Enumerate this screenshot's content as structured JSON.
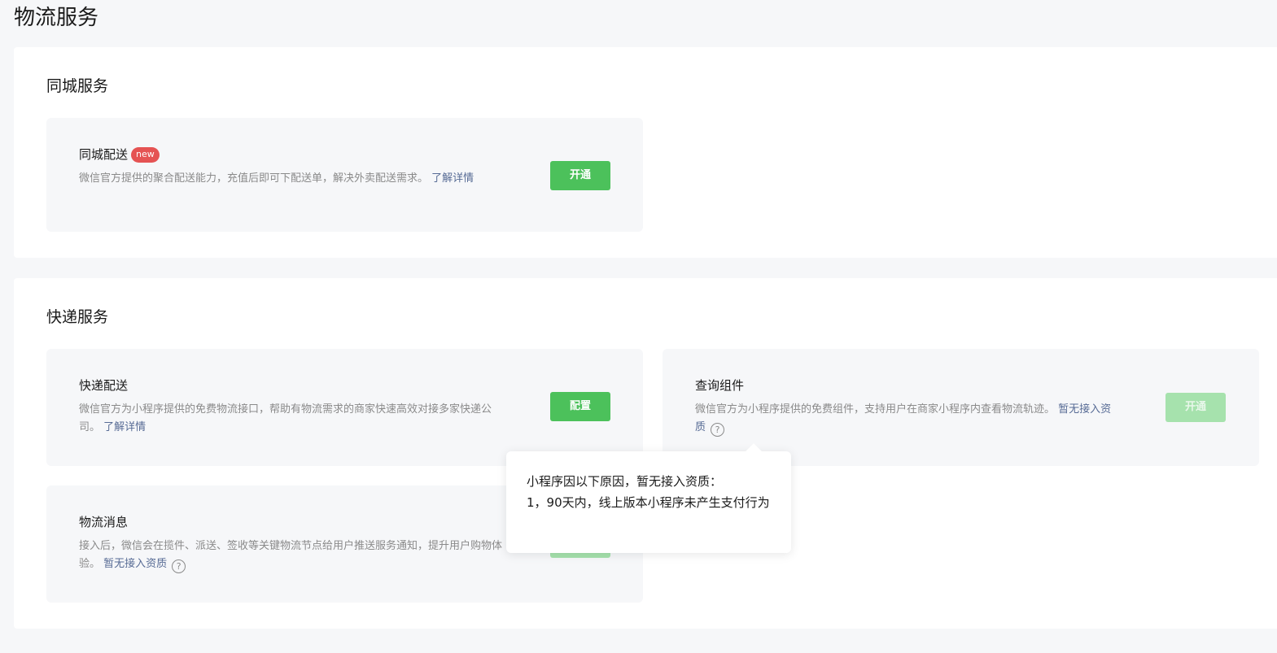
{
  "page": {
    "title": "物流服务"
  },
  "city_section": {
    "title": "同城服务",
    "cards": [
      {
        "title": "同城配送",
        "badge": "new",
        "desc": "微信官方提供的聚合配送能力，充值后即可下配送单，解决外卖配送需求。",
        "link": "了解详情",
        "button": "开通"
      }
    ]
  },
  "express_section": {
    "title": "快递服务",
    "cards": [
      {
        "title": "快递配送",
        "desc": "微信官方为小程序提供的免费物流接口，帮助有物流需求的商家快速高效对接多家快递公司。",
        "link": "了解详情",
        "button": "配置"
      },
      {
        "title": "查询组件",
        "desc": "微信官方为小程序提供的免费组件，支持用户在商家小程序内查看物流轨迹。",
        "link": "暂无接入资质",
        "help": "?",
        "button": "开通"
      },
      {
        "title": "物流消息",
        "desc": "接入后，微信会在揽件、派送、签收等关键物流节点给用户推送服务通知，提升用户购物体验。",
        "link": "暂无接入资质",
        "help": "?"
      }
    ]
  },
  "tooltip": {
    "heading": "小程序因以下原因，暂无接入资质：",
    "reason": "1，90天内，线上版本小程序未产生支付行为"
  },
  "colors": {
    "primary_green": "#4cc15b",
    "disabled_green": "#a6e2ad",
    "link_blue": "#576b95",
    "badge_red": "#e55353"
  }
}
